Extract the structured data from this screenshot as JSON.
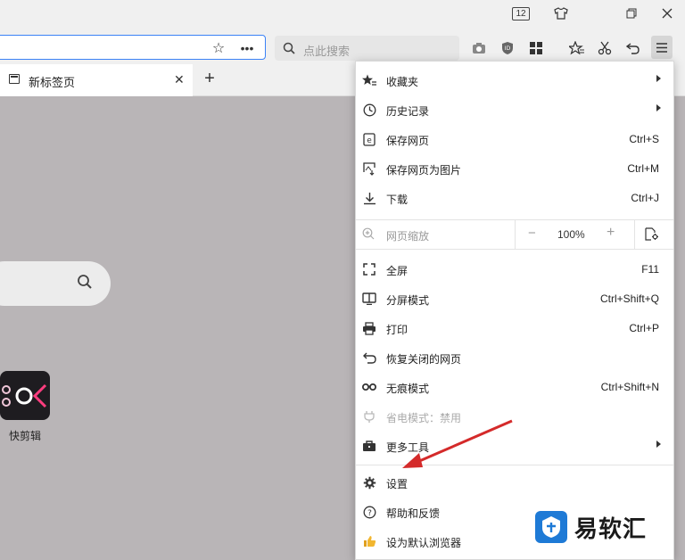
{
  "window": {
    "tab_count_badge": "12",
    "controls": [
      "skin-icon",
      "restore-icon",
      "close-icon"
    ]
  },
  "toolbar": {
    "search_placeholder": "点此搜索",
    "icons": [
      "camera-icon",
      "shield-icon",
      "apps-icon",
      "favorites-icon",
      "scissors-icon",
      "undo-icon",
      "menu-icon"
    ]
  },
  "tabs": [
    {
      "label": "新标签页",
      "active": true
    }
  ],
  "page": {
    "app_label": "快剪辑"
  },
  "menu": {
    "items_top": [
      {
        "icon": "star-list-icon",
        "label": "收藏夹",
        "shortcut": "",
        "submenu": true
      },
      {
        "icon": "clock-icon",
        "label": "历史记录",
        "shortcut": "",
        "submenu": true
      },
      {
        "icon": "save-page-icon",
        "label": "保存网页",
        "shortcut": "Ctrl+S",
        "submenu": false
      },
      {
        "icon": "save-image-icon",
        "label": "保存网页为图片",
        "shortcut": "Ctrl+M",
        "submenu": false
      },
      {
        "icon": "download-icon",
        "label": "下载",
        "shortcut": "Ctrl+J",
        "submenu": false
      }
    ],
    "zoom": {
      "label": "网页缩放",
      "minus": "−",
      "value": "100%",
      "plus": "+"
    },
    "items_mid": [
      {
        "icon": "fullscreen-icon",
        "label": "全屏",
        "shortcut": "F11",
        "submenu": false,
        "disabled": false
      },
      {
        "icon": "split-screen-icon",
        "label": "分屏模式",
        "shortcut": "Ctrl+Shift+Q",
        "submenu": false,
        "disabled": false
      },
      {
        "icon": "print-icon",
        "label": "打印",
        "shortcut": "Ctrl+P",
        "submenu": false,
        "disabled": false
      },
      {
        "icon": "restore-closed-icon",
        "label": "恢复关闭的网页",
        "shortcut": "",
        "submenu": false,
        "disabled": false
      },
      {
        "icon": "incognito-icon",
        "label": "无痕模式",
        "shortcut": "Ctrl+Shift+N",
        "submenu": false,
        "disabled": false
      },
      {
        "icon": "power-plug-icon",
        "label": "省电模式：禁用",
        "shortcut": "",
        "submenu": false,
        "disabled": true
      },
      {
        "icon": "toolbox-icon",
        "label": "更多工具",
        "shortcut": "",
        "submenu": true,
        "disabled": false
      }
    ],
    "items_bottom": [
      {
        "icon": "gear-icon",
        "label": "设置",
        "shortcut": ""
      },
      {
        "icon": "help-icon",
        "label": "帮助和反馈",
        "shortcut": ""
      },
      {
        "icon": "thumbs-up-icon",
        "label": "设为默认浏览器",
        "shortcut": ""
      }
    ]
  },
  "annotation": {
    "arrow_color": "#d42a2a"
  },
  "watermark": {
    "text": "易软汇"
  },
  "colors": {
    "accent": "#3b82f6",
    "page_bg": "#b9b5b7",
    "toolbar_bg": "#f0f0f0"
  }
}
